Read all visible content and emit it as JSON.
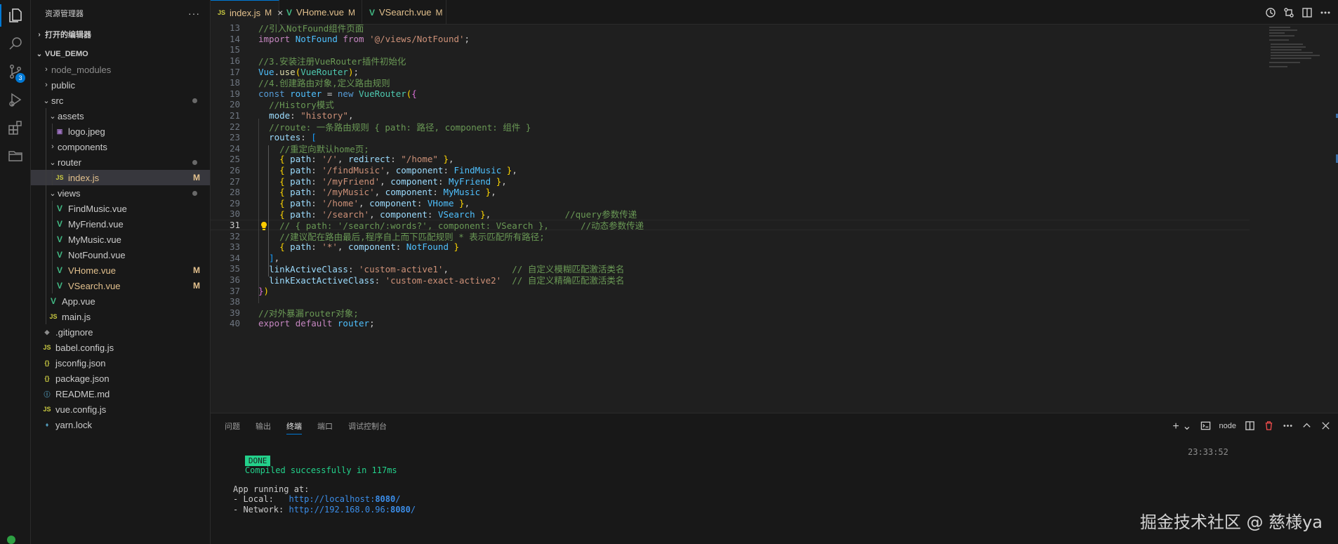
{
  "activity_bar": [
    {
      "name": "explorer-icon"
    },
    {
      "name": "search-icon"
    },
    {
      "name": "source-control-icon",
      "badge": "3"
    },
    {
      "name": "run-debug-icon"
    },
    {
      "name": "extensions-icon"
    },
    {
      "name": "remote-explorer-icon"
    }
  ],
  "sidebar": {
    "title": "资源管理器",
    "more": "···",
    "open_editors": "打开的编辑器",
    "workspace": "VUE_DEMO",
    "tree": [
      {
        "label": "node_modules",
        "depth": 1,
        "kind": "folder",
        "open": false,
        "dim": true
      },
      {
        "label": "public",
        "depth": 1,
        "kind": "folder",
        "open": false
      },
      {
        "label": "src",
        "depth": 1,
        "kind": "folder",
        "open": true,
        "dot": true
      },
      {
        "label": "assets",
        "depth": 2,
        "kind": "folder",
        "open": true
      },
      {
        "label": "logo.jpeg",
        "depth": 3,
        "kind": "img"
      },
      {
        "label": "components",
        "depth": 2,
        "kind": "folder",
        "open": false
      },
      {
        "label": "router",
        "depth": 2,
        "kind": "folder",
        "open": true,
        "dot": true
      },
      {
        "label": "index.js",
        "depth": 3,
        "kind": "js",
        "status": "M",
        "selected": true
      },
      {
        "label": "views",
        "depth": 2,
        "kind": "folder",
        "open": true,
        "dot": true
      },
      {
        "label": "FindMusic.vue",
        "depth": 3,
        "kind": "vue"
      },
      {
        "label": "MyFriend.vue",
        "depth": 3,
        "kind": "vue"
      },
      {
        "label": "MyMusic.vue",
        "depth": 3,
        "kind": "vue"
      },
      {
        "label": "NotFound.vue",
        "depth": 3,
        "kind": "vue"
      },
      {
        "label": "VHome.vue",
        "depth": 3,
        "kind": "vue",
        "status": "M"
      },
      {
        "label": "VSearch.vue",
        "depth": 3,
        "kind": "vue",
        "status": "M"
      },
      {
        "label": "App.vue",
        "depth": 2,
        "kind": "vue"
      },
      {
        "label": "main.js",
        "depth": 2,
        "kind": "js"
      },
      {
        "label": ".gitignore",
        "depth": 1,
        "kind": "git"
      },
      {
        "label": "babel.config.js",
        "depth": 1,
        "kind": "js"
      },
      {
        "label": "jsconfig.json",
        "depth": 1,
        "kind": "json"
      },
      {
        "label": "package.json",
        "depth": 1,
        "kind": "json"
      },
      {
        "label": "README.md",
        "depth": 1,
        "kind": "info"
      },
      {
        "label": "vue.config.js",
        "depth": 1,
        "kind": "js"
      },
      {
        "label": "yarn.lock",
        "depth": 1,
        "kind": "yarn"
      }
    ]
  },
  "tabs": [
    {
      "label": "index.js",
      "status": "M",
      "kind": "js",
      "active": true
    },
    {
      "label": "VHome.vue",
      "status": "M",
      "kind": "vue"
    },
    {
      "label": "VSearch.vue",
      "status": "M",
      "kind": "vue"
    }
  ],
  "file_icon_text": {
    "js": "JS",
    "vue": "V",
    "json": "{}",
    "info": "ⓘ",
    "git": "◆",
    "img": "▣",
    "yarn": "♦"
  },
  "editor": {
    "current_line": 31,
    "lines": [
      {
        "n": 13,
        "t": [
          [
            "cm",
            "//引入NotFound组件页面"
          ]
        ]
      },
      {
        "n": 14,
        "t": [
          [
            "kw",
            "import "
          ],
          [
            "id",
            "NotFound "
          ],
          [
            "kw",
            "from "
          ],
          [
            "str",
            "'@/views/NotFound'"
          ],
          [
            "p",
            ";"
          ]
        ]
      },
      {
        "n": 15,
        "t": []
      },
      {
        "n": 16,
        "t": [
          [
            "cm",
            "//3.安装注册VueRouter插件初始化"
          ]
        ]
      },
      {
        "n": 17,
        "t": [
          [
            "id",
            "Vue"
          ],
          [
            "p",
            "."
          ],
          [
            "fn",
            "use"
          ],
          [
            "b1",
            "("
          ],
          [
            "cls",
            "VueRouter"
          ],
          [
            "b1",
            ")"
          ],
          [
            "p",
            ";"
          ]
        ]
      },
      {
        "n": 18,
        "t": [
          [
            "cm",
            "//4.创建路由对象,定义路由规则"
          ]
        ]
      },
      {
        "n": 19,
        "t": [
          [
            "st",
            "const "
          ],
          [
            "id",
            "router "
          ],
          [
            "p",
            "= "
          ],
          [
            "st",
            "new "
          ],
          [
            "cls",
            "VueRouter"
          ],
          [
            "b1",
            "("
          ],
          [
            "b2",
            "{"
          ]
        ]
      },
      {
        "n": 20,
        "t": [
          [
            "p",
            "  "
          ],
          [
            "cm",
            "//History模式"
          ]
        ]
      },
      {
        "n": 21,
        "t": [
          [
            "p",
            "  "
          ],
          [
            "prop",
            "mode"
          ],
          [
            "p",
            ": "
          ],
          [
            "str",
            "\"history\""
          ],
          [
            "p",
            ","
          ]
        ]
      },
      {
        "n": 22,
        "t": [
          [
            "p",
            "  "
          ],
          [
            "cm",
            "//route: 一条路由规则 { path: 路径, component: 组件 }"
          ]
        ]
      },
      {
        "n": 23,
        "t": [
          [
            "p",
            "  "
          ],
          [
            "prop",
            "routes"
          ],
          [
            "p",
            ": "
          ],
          [
            "b3",
            "["
          ]
        ]
      },
      {
        "n": 24,
        "t": [
          [
            "p",
            "    "
          ],
          [
            "cm",
            "//重定向默认home页;"
          ]
        ]
      },
      {
        "n": 25,
        "t": [
          [
            "p",
            "    "
          ],
          [
            "b1",
            "{ "
          ],
          [
            "prop",
            "path"
          ],
          [
            "p",
            ": "
          ],
          [
            "str",
            "'/'"
          ],
          [
            "p",
            ", "
          ],
          [
            "prop",
            "redirect"
          ],
          [
            "p",
            ": "
          ],
          [
            "str",
            "\"/home\""
          ],
          [
            "b1",
            " }"
          ],
          [
            "p",
            ","
          ]
        ]
      },
      {
        "n": 26,
        "t": [
          [
            "p",
            "    "
          ],
          [
            "b1",
            "{ "
          ],
          [
            "prop",
            "path"
          ],
          [
            "p",
            ": "
          ],
          [
            "str",
            "'/findMusic'"
          ],
          [
            "p",
            ", "
          ],
          [
            "prop",
            "component"
          ],
          [
            "p",
            ": "
          ],
          [
            "id",
            "FindMusic"
          ],
          [
            "b1",
            " }"
          ],
          [
            "p",
            ","
          ]
        ]
      },
      {
        "n": 27,
        "t": [
          [
            "p",
            "    "
          ],
          [
            "b1",
            "{ "
          ],
          [
            "prop",
            "path"
          ],
          [
            "p",
            ": "
          ],
          [
            "str",
            "'/myFriend'"
          ],
          [
            "p",
            ", "
          ],
          [
            "prop",
            "component"
          ],
          [
            "p",
            ": "
          ],
          [
            "id",
            "MyFriend"
          ],
          [
            "b1",
            " }"
          ],
          [
            "p",
            ","
          ]
        ]
      },
      {
        "n": 28,
        "t": [
          [
            "p",
            "    "
          ],
          [
            "b1",
            "{ "
          ],
          [
            "prop",
            "path"
          ],
          [
            "p",
            ": "
          ],
          [
            "str",
            "'/myMusic'"
          ],
          [
            "p",
            ", "
          ],
          [
            "prop",
            "component"
          ],
          [
            "p",
            ": "
          ],
          [
            "id",
            "MyMusic"
          ],
          [
            "b1",
            " }"
          ],
          [
            "p",
            ","
          ]
        ]
      },
      {
        "n": 29,
        "t": [
          [
            "p",
            "    "
          ],
          [
            "b1",
            "{ "
          ],
          [
            "prop",
            "path"
          ],
          [
            "p",
            ": "
          ],
          [
            "str",
            "'/home'"
          ],
          [
            "p",
            ", "
          ],
          [
            "prop",
            "component"
          ],
          [
            "p",
            ": "
          ],
          [
            "id",
            "VHome"
          ],
          [
            "b1",
            " }"
          ],
          [
            "p",
            ","
          ]
        ]
      },
      {
        "n": 30,
        "t": [
          [
            "p",
            "    "
          ],
          [
            "b1",
            "{ "
          ],
          [
            "prop",
            "path"
          ],
          [
            "p",
            ": "
          ],
          [
            "str",
            "'/search'"
          ],
          [
            "p",
            ", "
          ],
          [
            "prop",
            "component"
          ],
          [
            "p",
            ": "
          ],
          [
            "id",
            "VSearch"
          ],
          [
            "b1",
            " }"
          ],
          [
            "p",
            ",              "
          ],
          [
            "cm",
            "//query参数传递"
          ]
        ]
      },
      {
        "n": 31,
        "t": [
          [
            "p",
            "    "
          ],
          [
            "cm",
            "// { path: '/search/:words?', component: VSearch },      //动态参数传递"
          ]
        ]
      },
      {
        "n": 32,
        "t": [
          [
            "p",
            "    "
          ],
          [
            "cm",
            "//建议配在路由最后,程序自上而下匹配规则 * 表示匹配所有路径;"
          ]
        ]
      },
      {
        "n": 33,
        "t": [
          [
            "p",
            "    "
          ],
          [
            "b1",
            "{ "
          ],
          [
            "prop",
            "path"
          ],
          [
            "p",
            ": "
          ],
          [
            "str",
            "'*'"
          ],
          [
            "p",
            ", "
          ],
          [
            "prop",
            "component"
          ],
          [
            "p",
            ": "
          ],
          [
            "id",
            "NotFound"
          ],
          [
            "b1",
            " }"
          ]
        ]
      },
      {
        "n": 34,
        "t": [
          [
            "p",
            "  "
          ],
          [
            "b3",
            "]"
          ],
          [
            "p",
            ","
          ]
        ]
      },
      {
        "n": 35,
        "t": [
          [
            "p",
            "  "
          ],
          [
            "prop",
            "linkActiveClass"
          ],
          [
            "p",
            ": "
          ],
          [
            "str",
            "'custom-active1'"
          ],
          [
            "p",
            ",            "
          ],
          [
            "cm",
            "// 自定义模糊匹配激活类名"
          ]
        ]
      },
      {
        "n": 36,
        "t": [
          [
            "p",
            "  "
          ],
          [
            "prop",
            "linkExactActiveClass"
          ],
          [
            "p",
            ": "
          ],
          [
            "str",
            "'custom-exact-active2'"
          ],
          [
            "p",
            "  "
          ],
          [
            "cm",
            "// 自定义精确匹配激活类名"
          ]
        ]
      },
      {
        "n": 37,
        "t": [
          [
            "b2",
            "}"
          ],
          [
            "b1",
            ")"
          ]
        ]
      },
      {
        "n": 38,
        "t": []
      },
      {
        "n": 39,
        "t": [
          [
            "cm",
            "//对外暴漏router对象;"
          ]
        ]
      },
      {
        "n": 40,
        "t": [
          [
            "kw",
            "export "
          ],
          [
            "kw",
            "default "
          ],
          [
            "id",
            "router"
          ],
          [
            "p",
            ";"
          ]
        ]
      }
    ]
  },
  "panel": {
    "tabs": [
      "问题",
      "输出",
      "终端",
      "端口",
      "调试控制台"
    ],
    "active_tab": "终端",
    "shell": "node",
    "terminal": {
      "badge": "DONE",
      "message": "Compiled successfully in 117ms",
      "time": "23:33:52",
      "running": "App running at:",
      "local_label": "- Local:   ",
      "local_url": "http://localhost:",
      "local_port": "8080",
      "local_tail": "/",
      "network_label": "- Network: ",
      "network_url": "http://192.168.0.96:",
      "network_port": "8080",
      "network_tail": "/"
    }
  },
  "watermark": "掘金技术社区 @ 慈様ya",
  "colors": {
    "accent": "#0078d4",
    "modified": "#e2c08d",
    "done": "#23d18b"
  }
}
